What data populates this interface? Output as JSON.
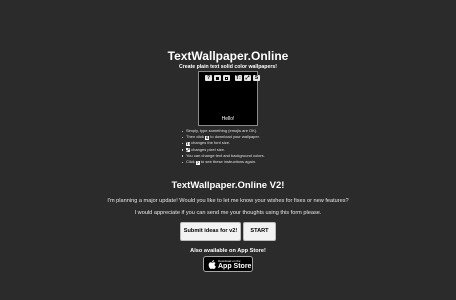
{
  "header": {
    "title": "TextWallpaper.Online",
    "subtitle": "Create plain text solid color wallpapers!"
  },
  "preview": {
    "text": "Hello!",
    "toolbar": {
      "help_glyph": "?",
      "size_glyph": "T↕",
      "save_glyph": "S",
      "expand_glyph": "⤢"
    }
  },
  "instructions": {
    "item1": "Simply, type something (emojis are OK).",
    "item2_pre": "Then click",
    "item2_post": "to download your wallpaper.",
    "item3_post": "changes the font size.",
    "item4_post": "changes pixel size.",
    "item5": "You can change text and background colors.",
    "item6_pre": "Click",
    "item6_post": "to see these instructions again."
  },
  "announcement": {
    "title": "TextWallpaper.Online V2!",
    "line1": "I'm planning a major update! Would you like to let me know your wishes for fixes or new features?",
    "line2": "I would appreciate if you can send me your thoughts using this form please."
  },
  "buttons": {
    "submit_label": "Submit ideas for v2!",
    "start_label": "START"
  },
  "appstore": {
    "label": "Also available on App Store!",
    "badge_small": "Download on the",
    "badge_big": "App Store"
  }
}
